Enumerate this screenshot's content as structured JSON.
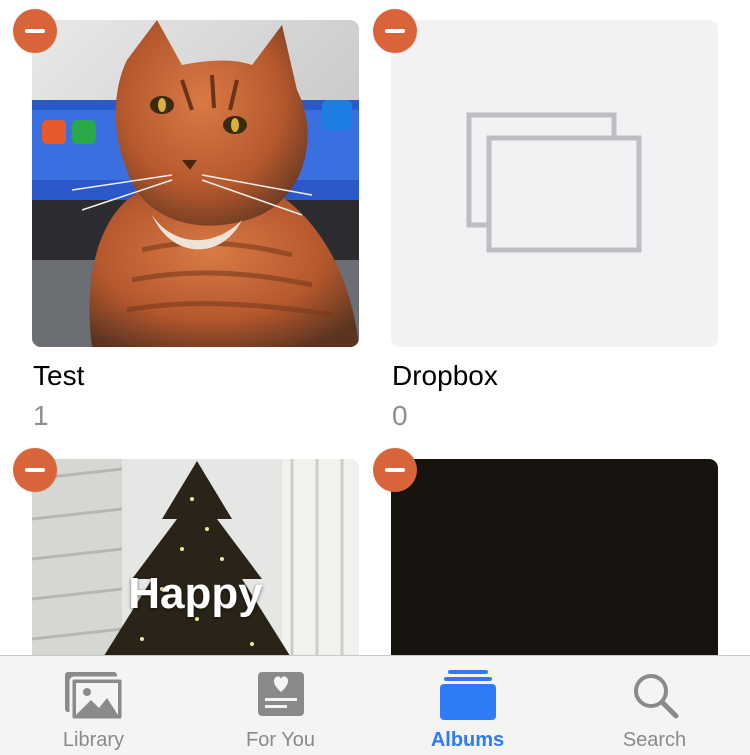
{
  "albums": [
    {
      "name": "Test",
      "count": "1",
      "thumbnail": "cat-photo"
    },
    {
      "name": "Dropbox",
      "count": "0",
      "thumbnail": "empty-album-placeholder"
    },
    {
      "name": "",
      "count": "",
      "thumbnail": "christmas-tree-photo",
      "overlay_text": "Happy"
    },
    {
      "name": "",
      "count": "",
      "thumbnail": "black-photo"
    }
  ],
  "tabbar": {
    "tabs": [
      {
        "label": "Library",
        "icon": "photo-library-icon",
        "active": false
      },
      {
        "label": "For You",
        "icon": "for-you-icon",
        "active": false
      },
      {
        "label": "Albums",
        "icon": "albums-icon",
        "active": true
      },
      {
        "label": "Search",
        "icon": "search-icon",
        "active": false
      }
    ]
  },
  "colors": {
    "delete_badge": "#d9643a",
    "active_tab": "#2f7bf5",
    "inactive_tab": "#8a8a8a",
    "count_text": "#8e8e93"
  }
}
